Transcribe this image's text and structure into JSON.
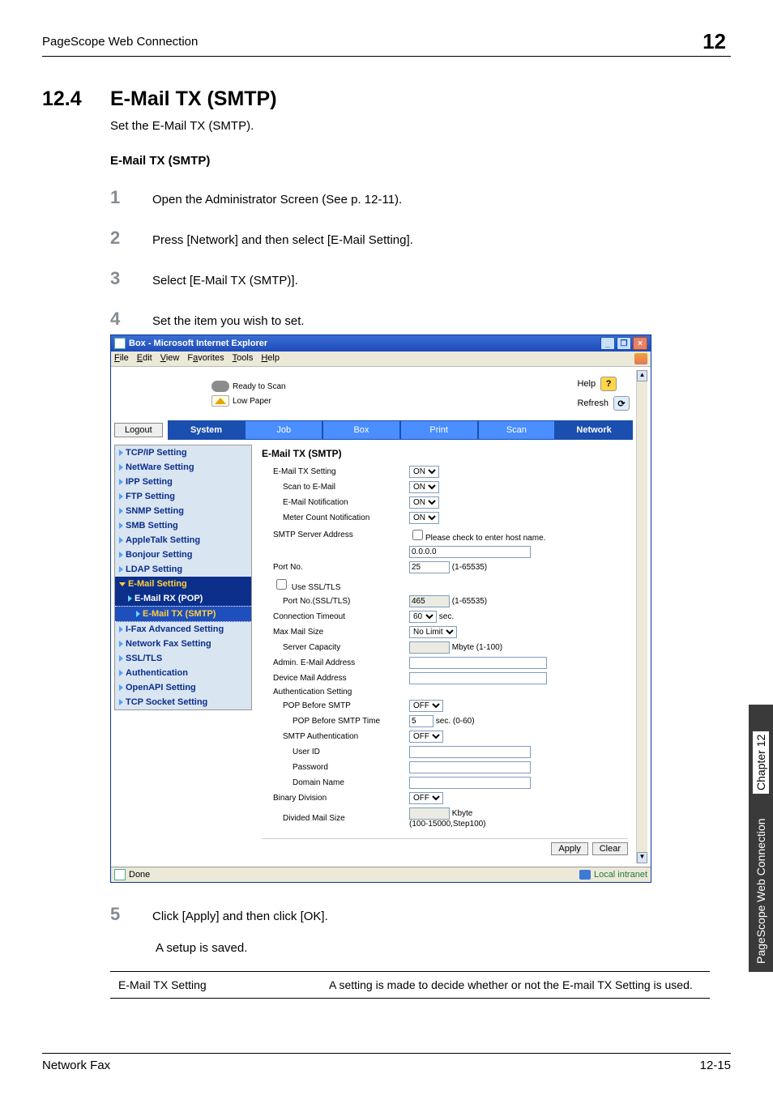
{
  "header": {
    "left": "PageScope Web Connection",
    "right": "12"
  },
  "section": {
    "num": "12.4",
    "title": "E-Mail TX (SMTP)"
  },
  "intro": "Set the E-Mail TX (SMTP).",
  "subhead": "E-Mail TX (SMTP)",
  "steps": [
    {
      "n": "1",
      "t": "Open the Administrator Screen (See p. 12-11)."
    },
    {
      "n": "2",
      "t": "Press [Network] and then select [E-Mail Setting]."
    },
    {
      "n": "3",
      "t": "Select [E-Mail TX (SMTP)]."
    },
    {
      "n": "4",
      "t": "Set the item you wish to set."
    },
    {
      "n": "5",
      "t": "Click [Apply] and then click [OK]."
    }
  ],
  "result": "A setup is saved.",
  "shot": {
    "title": "Box - Microsoft Internet Explorer",
    "menus": [
      "File",
      "Edit",
      "View",
      "Favorites",
      "Tools",
      "Help"
    ],
    "status": {
      "ready": "Ready to Scan",
      "low": "Low Paper"
    },
    "help": {
      "help": "Help",
      "refresh": "Refresh"
    },
    "logout": "Logout",
    "tabs": [
      "System",
      "Job",
      "Box",
      "Print",
      "Scan",
      "Network"
    ],
    "nav": [
      "TCP/IP Setting",
      "NetWare Setting",
      "IPP Setting",
      "FTP Setting",
      "SNMP Setting",
      "SMB Setting",
      "AppleTalk Setting",
      "Bonjour Setting",
      "LDAP Setting",
      "E-Mail Setting",
      "E-Mail RX (POP)",
      "E-Mail TX (SMTP)",
      "I-Fax Advanced Setting",
      "Network Fax Setting",
      "SSL/TLS",
      "Authentication",
      "OpenAPI Setting",
      "TCP Socket Setting"
    ],
    "form": {
      "heading": "E-Mail TX (SMTP)",
      "email_tx_setting": {
        "label": "E-Mail TX Setting",
        "value": "ON"
      },
      "scan_to_email": {
        "label": "Scan to E-Mail",
        "value": "ON"
      },
      "email_notification": {
        "label": "E-Mail Notification",
        "value": "ON"
      },
      "meter_count_notification": {
        "label": "Meter Count Notification",
        "value": "ON"
      },
      "smtp_server_address": {
        "label": "SMTP Server Address",
        "check": "Please check to enter host name.",
        "value": "0.0.0.0"
      },
      "port_no": {
        "label": "Port No.",
        "value": "25",
        "range": "(1-65535)"
      },
      "use_ssl": {
        "label": "Use SSL/TLS",
        "checked": false
      },
      "port_no_ssl": {
        "label": "Port No.(SSL/TLS)",
        "value": "465",
        "range": "(1-65535)"
      },
      "conn_timeout": {
        "label": "Connection Timeout",
        "value": "60",
        "unit": "sec."
      },
      "max_mail_size": {
        "label": "Max Mail Size",
        "value": "No Limit"
      },
      "server_capacity": {
        "label": "Server Capacity",
        "value": "",
        "unit": "Mbyte (1-100)"
      },
      "admin_email": {
        "label": "Admin. E-Mail Address",
        "value": ""
      },
      "device_mail": {
        "label": "Device Mail Address",
        "value": ""
      },
      "auth_setting": {
        "label": "Authentication Setting"
      },
      "pop_before_smtp": {
        "label": "POP Before SMTP",
        "value": "OFF"
      },
      "pop_before_smtp_time": {
        "label": "POP Before SMTP Time",
        "value": "5",
        "unit": "sec. (0-60)"
      },
      "smtp_auth": {
        "label": "SMTP Authentication",
        "value": "OFF"
      },
      "user_id": {
        "label": "User ID",
        "value": ""
      },
      "password": {
        "label": "Password",
        "value": ""
      },
      "domain": {
        "label": "Domain Name",
        "value": ""
      },
      "binary_division": {
        "label": "Binary Division",
        "value": "OFF"
      },
      "divided_mail_size": {
        "label": "Divided Mail Size",
        "value": "",
        "unit": "Kbyte",
        "range": "(100-15000,Step100)"
      },
      "apply": "Apply",
      "clear": "Clear"
    },
    "statusbar": {
      "done": "Done",
      "zone": "Local intranet"
    }
  },
  "table": {
    "c1": "E-Mail TX Setting",
    "c2": "A setting is made to decide whether or not the E-mail TX Setting is used."
  },
  "side": {
    "conn": "PageScope Web Connection",
    "chap": "Chapter 12"
  },
  "footer": {
    "left": "Network Fax",
    "right": "12-15"
  }
}
